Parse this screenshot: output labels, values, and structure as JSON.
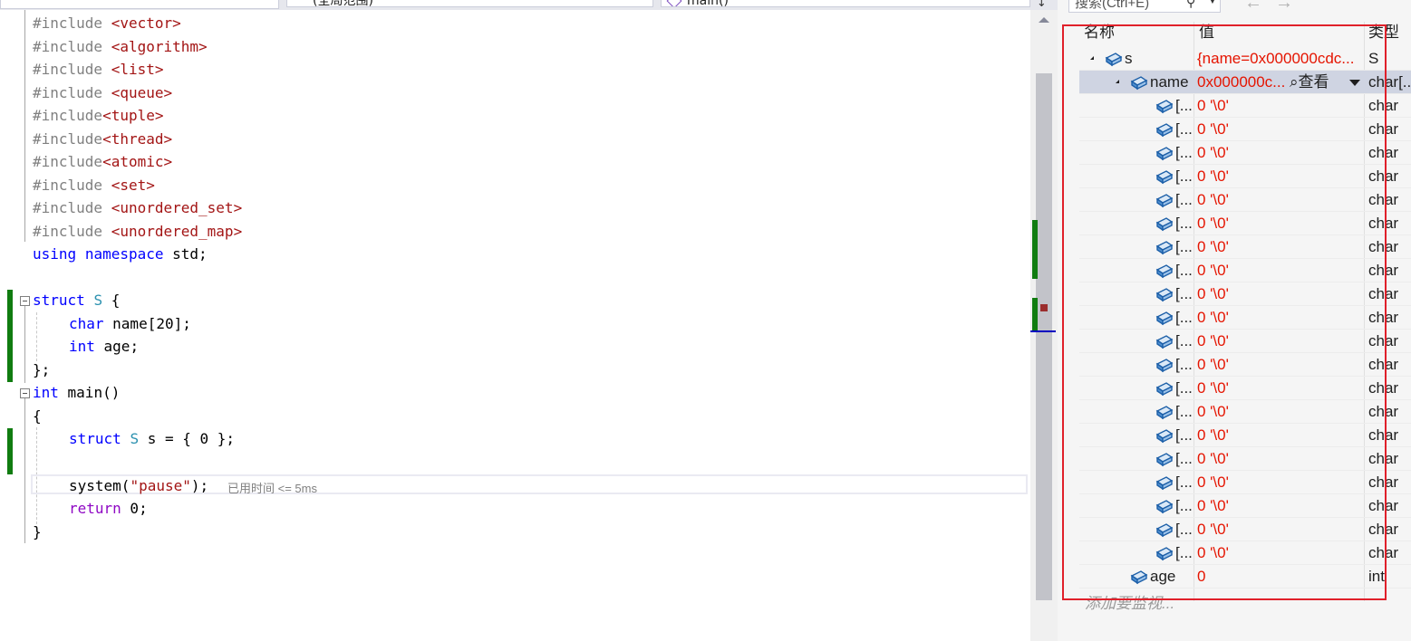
{
  "navbar": {
    "scope_label": "(全局范围)",
    "function_label": "main()",
    "split_icon": "split-arrow-icon"
  },
  "code": {
    "includes": [
      {
        "kw": "#include ",
        "hdr": "<vector>"
      },
      {
        "kw": "#include ",
        "hdr": "<algorithm>"
      },
      {
        "kw": "#include ",
        "hdr": "<list>"
      },
      {
        "kw": "#include ",
        "hdr": "<queue>"
      },
      {
        "kw": "#include",
        "hdr": "<tuple>"
      },
      {
        "kw": "#include",
        "hdr": "<thread>"
      },
      {
        "kw": "#include",
        "hdr": "<atomic>"
      },
      {
        "kw": "#include ",
        "hdr": "<set>"
      },
      {
        "kw": "#include ",
        "hdr": "<unordered_set>"
      },
      {
        "kw": "#include ",
        "hdr": "<unordered_map>"
      }
    ],
    "using_kw": "using",
    "namespace_kw": "namespace",
    "using_rest": " std;",
    "struct_kw": "struct",
    "struct_name": "S",
    "open_brace_struct": " {",
    "char_kw": "char",
    "name_decl": " name[20];",
    "int_kw": "int",
    "age_decl": " age;",
    "close_struct": "};",
    "int_kw_main": "int",
    "main_decl": " main()",
    "open_brace": "{",
    "decl_struct_kw": "struct",
    "decl_type": "S",
    "decl_rest": " s = { 0 };",
    "system_call": "system(",
    "pause_str": "\"pause\"",
    "system_end": ");",
    "elapsed_hint": "已用时间 <= 5ms",
    "return_kw": "return",
    "return_rest": " 0;",
    "close_brace": "}"
  },
  "watch": {
    "search_placeholder": "搜索(Ctrl+E)",
    "search_icon": "search-icon",
    "back_icon": "arrow-left-icon",
    "forward_icon": "arrow-right-icon",
    "back_glyph": "←",
    "forward_glyph": "→",
    "col_name": "名称",
    "col_value": "值",
    "col_type": "类型",
    "rows": [
      {
        "name": "s",
        "value": "{name=0x000000cdc...",
        "type": "S",
        "level": 0,
        "expanded": true
      },
      {
        "name": "name",
        "value": "0x000000c...",
        "type": "char[...",
        "level": 1,
        "expanded": true,
        "selected": true,
        "viewer": "查看"
      },
      {
        "name": "[...",
        "value": "0 '\\0'",
        "type": "char",
        "level": 2
      },
      {
        "name": "[...",
        "value": "0 '\\0'",
        "type": "char",
        "level": 2
      },
      {
        "name": "[...",
        "value": "0 '\\0'",
        "type": "char",
        "level": 2
      },
      {
        "name": "[...",
        "value": "0 '\\0'",
        "type": "char",
        "level": 2
      },
      {
        "name": "[...",
        "value": "0 '\\0'",
        "type": "char",
        "level": 2
      },
      {
        "name": "[...",
        "value": "0 '\\0'",
        "type": "char",
        "level": 2
      },
      {
        "name": "[...",
        "value": "0 '\\0'",
        "type": "char",
        "level": 2
      },
      {
        "name": "[...",
        "value": "0 '\\0'",
        "type": "char",
        "level": 2
      },
      {
        "name": "[...",
        "value": "0 '\\0'",
        "type": "char",
        "level": 2
      },
      {
        "name": "[...",
        "value": "0 '\\0'",
        "type": "char",
        "level": 2
      },
      {
        "name": "[...",
        "value": "0 '\\0'",
        "type": "char",
        "level": 2
      },
      {
        "name": "[...",
        "value": "0 '\\0'",
        "type": "char",
        "level": 2
      },
      {
        "name": "[...",
        "value": "0 '\\0'",
        "type": "char",
        "level": 2
      },
      {
        "name": "[...",
        "value": "0 '\\0'",
        "type": "char",
        "level": 2
      },
      {
        "name": "[...",
        "value": "0 '\\0'",
        "type": "char",
        "level": 2
      },
      {
        "name": "[...",
        "value": "0 '\\0'",
        "type": "char",
        "level": 2
      },
      {
        "name": "[...",
        "value": "0 '\\0'",
        "type": "char",
        "level": 2
      },
      {
        "name": "[...",
        "value": "0 '\\0'",
        "type": "char",
        "level": 2
      },
      {
        "name": "[...",
        "value": "0 '\\0'",
        "type": "char",
        "level": 2
      },
      {
        "name": "[...",
        "value": "0 '\\0'",
        "type": "char",
        "level": 2
      },
      {
        "name": "age",
        "value": "0",
        "type": "int",
        "level": 1
      }
    ],
    "add_watch": "添加要监视..."
  },
  "colors": {
    "value_red": "#e51400",
    "highlight_box": "#e0202a",
    "change_green": "#107c10",
    "keyword_blue": "#0000ff",
    "type_teal": "#2b91af",
    "string_red": "#a31515"
  }
}
